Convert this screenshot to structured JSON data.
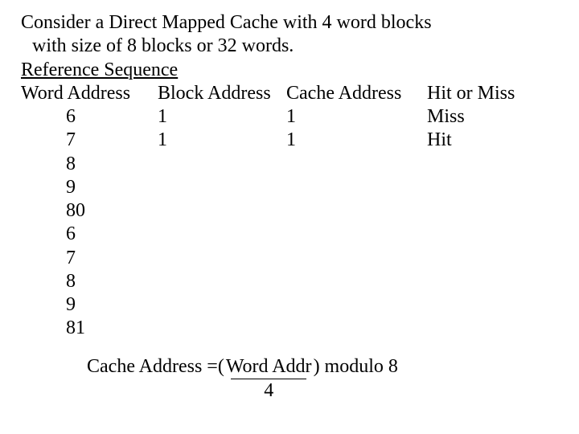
{
  "intro": {
    "line1": "Consider a Direct Mapped Cache with 4 word blocks",
    "line2": "with size of 8 blocks or 32 words.",
    "heading": "Reference Sequence"
  },
  "table": {
    "headers": {
      "word_address": "Word Address",
      "block_address": "Block Address",
      "cache_address": "Cache Address",
      "hit_or_miss": "Hit or Miss"
    },
    "rows": [
      {
        "wa": "6",
        "ba": "1",
        "ca": "1",
        "hm": "Miss"
      },
      {
        "wa": "7",
        "ba": "1",
        "ca": "1",
        "hm": "Hit"
      },
      {
        "wa": "8",
        "ba": "",
        "ca": "",
        "hm": ""
      },
      {
        "wa": "9",
        "ba": "",
        "ca": "",
        "hm": ""
      },
      {
        "wa": "80",
        "ba": "",
        "ca": "",
        "hm": ""
      },
      {
        "wa": "6",
        "ba": "",
        "ca": "",
        "hm": ""
      },
      {
        "wa": "7",
        "ba": "",
        "ca": "",
        "hm": ""
      },
      {
        "wa": "8",
        "ba": "",
        "ca": "",
        "hm": ""
      },
      {
        "wa": "9",
        "ba": "",
        "ca": "",
        "hm": ""
      },
      {
        "wa": "81",
        "ba": "",
        "ca": "",
        "hm": ""
      }
    ]
  },
  "formula": {
    "lhs": "Cache Address =(",
    "numerator": "Word Addr",
    "denominator": "4",
    "rhs": ") modulo 8"
  }
}
